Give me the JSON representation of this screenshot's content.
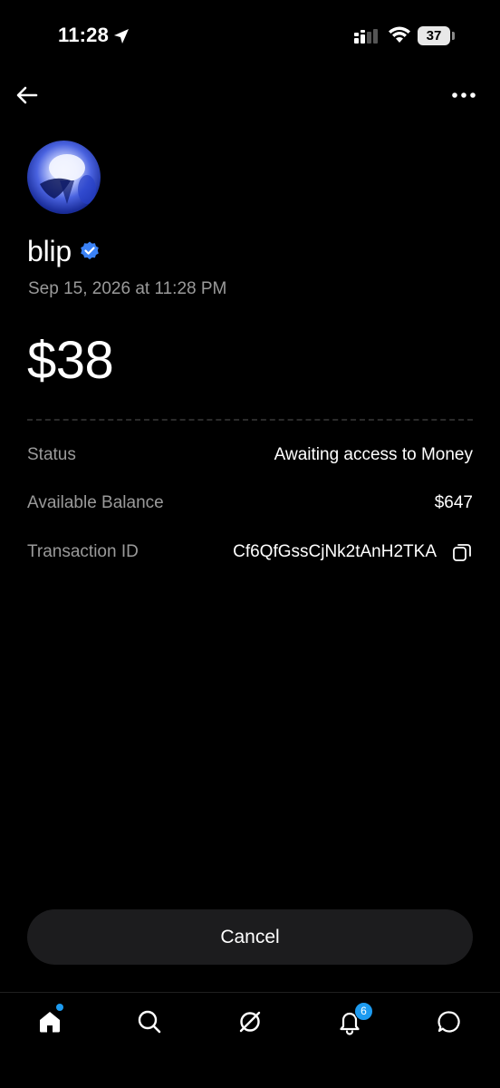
{
  "status_bar": {
    "time": "11:28",
    "battery": "37"
  },
  "payment": {
    "name": "blip",
    "date": "Sep 15, 2026 at 11:28 PM",
    "amount": "$38"
  },
  "details": [
    {
      "label": "Status",
      "value": "Awaiting access to Money"
    },
    {
      "label": "Available Balance",
      "value": "$647"
    },
    {
      "label": "Transaction ID",
      "value": "Cf6QfGssCjNk2tAnH2TKA"
    }
  ],
  "actions": {
    "cancel_label": "Cancel"
  },
  "tab_bar": {
    "tabs": [
      {
        "icon": "home-icon"
      },
      {
        "icon": "search-icon"
      },
      {
        "icon": "grok-icon"
      },
      {
        "icon": "bell-icon"
      },
      {
        "icon": "message-icon"
      }
    ],
    "notification_count": "6"
  },
  "colors": {
    "accent": "#1d9bf0",
    "verified": "#3b82f6",
    "muted_text": "#9a9a9a",
    "button_bg": "#1c1c1e"
  }
}
